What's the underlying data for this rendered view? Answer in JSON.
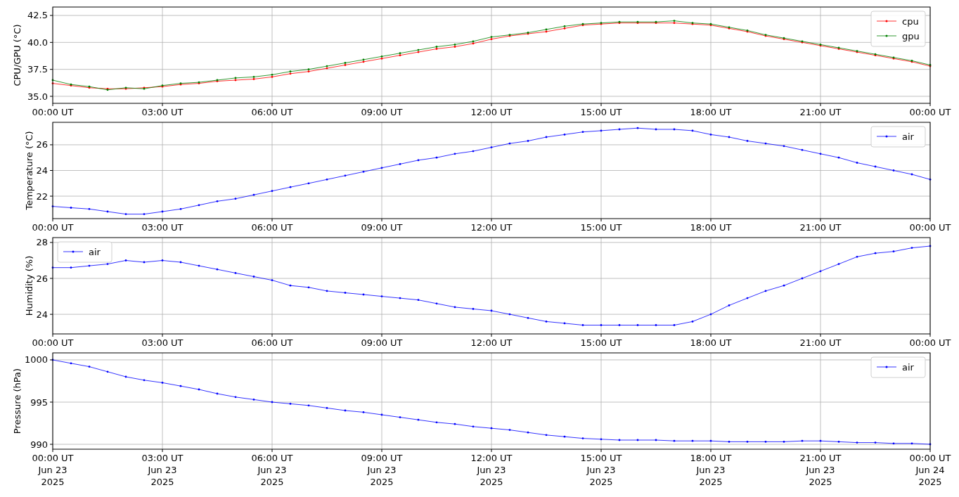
{
  "panels": [
    {
      "chart_data": {
        "type": "line",
        "grid": true,
        "legend": "upper right",
        "ylabel": "CPU/GPU (°C)",
        "ylim": [
          34.35,
          43.28
        ],
        "categories": [
          "00:00 UT",
          null,
          null,
          null,
          null,
          null,
          "03:00 UT",
          null,
          null,
          null,
          null,
          null,
          "06:00 UT",
          null,
          null,
          null,
          null,
          null,
          "09:00 UT",
          null,
          null,
          null,
          null,
          null,
          "12:00 UT",
          null,
          null,
          null,
          null,
          null,
          "15:00 UT",
          null,
          null,
          null,
          null,
          null,
          "18:00 UT",
          null,
          null,
          null,
          null,
          null,
          "21:00 UT",
          null,
          null,
          null,
          null,
          null,
          "00:00 UT"
        ],
        "yticks": [
          {
            "value": 35,
            "label": "35.0"
          },
          {
            "value": 37.5,
            "label": "37.5"
          },
          {
            "value": 40,
            "label": "40.0"
          },
          {
            "value": 42.5,
            "label": "42.5"
          }
        ],
        "series": [
          {
            "name": "cpu",
            "color": "#ff0000",
            "values": [
              36.2,
              36.0,
              35.8,
              35.7,
              35.7,
              35.8,
              35.9,
              36.1,
              36.2,
              36.4,
              36.5,
              36.6,
              36.8,
              37.1,
              37.3,
              37.6,
              37.9,
              38.2,
              38.5,
              38.8,
              39.1,
              39.4,
              39.6,
              39.9,
              40.3,
              40.6,
              40.8,
              41.0,
              41.3,
              41.6,
              41.7,
              41.8,
              41.8,
              41.8,
              41.8,
              41.7,
              41.6,
              41.3,
              41.0,
              40.6,
              40.3,
              40.0,
              39.7,
              39.4,
              39.1,
              38.8,
              38.5,
              38.2,
              37.8
            ]
          },
          {
            "name": "gpu",
            "color": "#008000",
            "values": [
              36.5,
              36.1,
              35.9,
              35.6,
              35.8,
              35.7,
              36.0,
              36.2,
              36.3,
              36.5,
              36.7,
              36.8,
              37.0,
              37.3,
              37.5,
              37.8,
              38.1,
              38.4,
              38.7,
              39.0,
              39.3,
              39.6,
              39.8,
              40.1,
              40.5,
              40.7,
              40.9,
              41.2,
              41.5,
              41.7,
              41.8,
              41.9,
              41.9,
              41.9,
              42.0,
              41.8,
              41.7,
              41.4,
              41.1,
              40.7,
              40.4,
              40.1,
              39.8,
              39.5,
              39.2,
              38.9,
              38.6,
              38.3,
              37.9
            ]
          }
        ]
      }
    },
    {
      "chart_data": {
        "type": "line",
        "grid": true,
        "legend": "upper right",
        "ylabel": "Temperature (°C)",
        "ylim": [
          20.25,
          27.75
        ],
        "categories": [
          "00:00 UT",
          null,
          null,
          null,
          null,
          null,
          "03:00 UT",
          null,
          null,
          null,
          null,
          null,
          "06:00 UT",
          null,
          null,
          null,
          null,
          null,
          "09:00 UT",
          null,
          null,
          null,
          null,
          null,
          "12:00 UT",
          null,
          null,
          null,
          null,
          null,
          "15:00 UT",
          null,
          null,
          null,
          null,
          null,
          "18:00 UT",
          null,
          null,
          null,
          null,
          null,
          "21:00 UT",
          null,
          null,
          null,
          null,
          null,
          "00:00 UT"
        ],
        "yticks": [
          {
            "value": 22,
            "label": "22"
          },
          {
            "value": 24,
            "label": "24"
          },
          {
            "value": 26,
            "label": "26"
          }
        ],
        "series": [
          {
            "name": "air",
            "color": "#0000ff",
            "values": [
              21.2,
              21.1,
              21.0,
              20.8,
              20.6,
              20.6,
              20.8,
              21.0,
              21.3,
              21.6,
              21.8,
              22.1,
              22.4,
              22.7,
              23.0,
              23.3,
              23.6,
              23.9,
              24.2,
              24.5,
              24.8,
              25.0,
              25.3,
              25.5,
              25.8,
              26.1,
              26.3,
              26.6,
              26.8,
              27.0,
              27.1,
              27.2,
              27.3,
              27.2,
              27.2,
              27.1,
              26.8,
              26.6,
              26.3,
              26.1,
              25.9,
              25.6,
              25.3,
              25.0,
              24.6,
              24.3,
              24.0,
              23.7,
              23.3
            ]
          }
        ]
      }
    },
    {
      "chart_data": {
        "type": "line",
        "grid": true,
        "legend": "upper left",
        "ylabel": "Humidity (%)",
        "ylim": [
          22.91,
          28.27
        ],
        "categories": [
          "00:00 UT",
          null,
          null,
          null,
          null,
          null,
          "03:00 UT",
          null,
          null,
          null,
          null,
          null,
          "06:00 UT",
          null,
          null,
          null,
          null,
          null,
          "09:00 UT",
          null,
          null,
          null,
          null,
          null,
          "12:00 UT",
          null,
          null,
          null,
          null,
          null,
          "15:00 UT",
          null,
          null,
          null,
          null,
          null,
          "18:00 UT",
          null,
          null,
          null,
          null,
          null,
          "21:00 UT",
          null,
          null,
          null,
          null,
          null,
          "00:00 UT"
        ],
        "yticks": [
          {
            "value": 24,
            "label": "24"
          },
          {
            "value": 26,
            "label": "26"
          },
          {
            "value": 28,
            "label": "28"
          }
        ],
        "series": [
          {
            "name": "air",
            "color": "#0000ff",
            "values": [
              26.6,
              26.6,
              26.7,
              26.8,
              27.0,
              26.9,
              27.0,
              26.9,
              26.7,
              26.5,
              26.3,
              26.1,
              25.9,
              25.6,
              25.5,
              25.3,
              25.2,
              25.1,
              25.0,
              24.9,
              24.8,
              24.6,
              24.4,
              24.3,
              24.2,
              24.0,
              23.8,
              23.6,
              23.5,
              23.4,
              23.4,
              23.4,
              23.4,
              23.4,
              23.4,
              23.6,
              24.0,
              24.5,
              24.9,
              25.3,
              25.6,
              26.0,
              26.4,
              26.8,
              27.2,
              27.4,
              27.5,
              27.7,
              27.8
            ]
          }
        ]
      }
    },
    {
      "chart_data": {
        "type": "line",
        "grid": true,
        "legend": "upper right",
        "ylabel": "Pressure (hPa)",
        "ylim": [
          989.42,
          1000.83
        ],
        "categories": [
          "00:00 UT\nJun 23\n2025",
          null,
          null,
          null,
          null,
          null,
          "03:00 UT\nJun 23\n2025",
          null,
          null,
          null,
          null,
          null,
          "06:00 UT\nJun 23\n2025",
          null,
          null,
          null,
          null,
          null,
          "09:00 UT\nJun 23\n2025",
          null,
          null,
          null,
          null,
          null,
          "12:00 UT\nJun 23\n2025",
          null,
          null,
          null,
          null,
          null,
          "15:00 UT\nJun 23\n2025",
          null,
          null,
          null,
          null,
          null,
          "18:00 UT\nJun 23\n2025",
          null,
          null,
          null,
          null,
          null,
          "21:00 UT\nJun 23\n2025",
          null,
          null,
          null,
          null,
          null,
          "00:00 UT\nJun 24\n2025"
        ],
        "yticks": [
          {
            "value": 990,
            "label": "990"
          },
          {
            "value": 995,
            "label": "995"
          },
          {
            "value": 1000,
            "label": "1000"
          }
        ],
        "series": [
          {
            "name": "air",
            "color": "#0000ff",
            "values": [
              1000.0,
              999.6,
              999.2,
              998.6,
              998.0,
              997.6,
              997.3,
              996.9,
              996.5,
              996.0,
              995.6,
              995.3,
              995.0,
              994.8,
              994.6,
              994.3,
              994.0,
              993.8,
              993.5,
              993.2,
              992.9,
              992.6,
              992.4,
              992.1,
              991.9,
              991.7,
              991.4,
              991.1,
              990.9,
              990.7,
              990.6,
              990.5,
              990.5,
              990.5,
              990.4,
              990.4,
              990.4,
              990.3,
              990.3,
              990.3,
              990.3,
              990.4,
              990.4,
              990.3,
              990.2,
              990.2,
              990.1,
              990.1,
              990.0
            ]
          }
        ]
      }
    }
  ]
}
